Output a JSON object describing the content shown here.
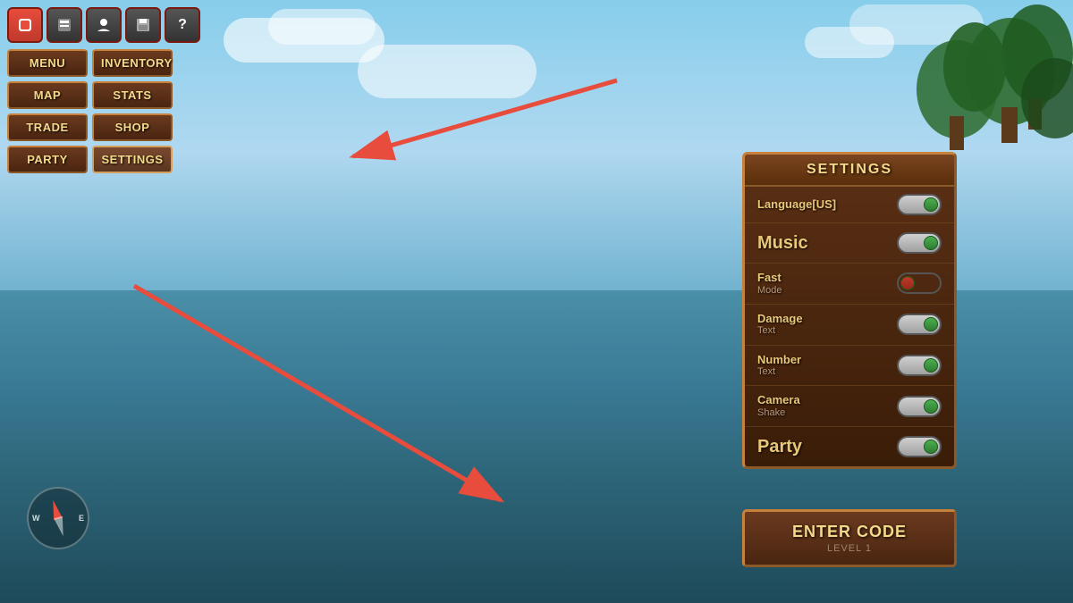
{
  "toolbar": {
    "icons": [
      "⬟",
      "📋",
      "👤",
      "💾",
      "?"
    ]
  },
  "nav": {
    "buttons": [
      {
        "label": "MENU",
        "id": "menu"
      },
      {
        "label": "INVENTORY",
        "id": "inventory"
      },
      {
        "label": "MAP",
        "id": "map"
      },
      {
        "label": "STATS",
        "id": "stats"
      },
      {
        "label": "TRADE",
        "id": "trade"
      },
      {
        "label": "SHOP",
        "id": "shop"
      },
      {
        "label": "PARTY",
        "id": "party"
      },
      {
        "label": "SETTINGS",
        "id": "settings"
      }
    ]
  },
  "settings": {
    "title": "SETTINGS",
    "rows": [
      {
        "label": "Language[US]",
        "size": "normal",
        "state": "on"
      },
      {
        "label": "Music",
        "size": "large",
        "state": "on"
      },
      {
        "label": "Fast",
        "sub": "Mode",
        "size": "normal",
        "state": "off"
      },
      {
        "label": "Damage",
        "sub": "Text",
        "size": "normal",
        "state": "on"
      },
      {
        "label": "Number",
        "sub": "Text",
        "size": "normal",
        "state": "on"
      },
      {
        "label": "Camera",
        "sub": "Shake",
        "size": "normal",
        "state": "on"
      },
      {
        "label": "Party",
        "size": "large",
        "state": "on"
      }
    ]
  },
  "enterCode": {
    "label": "ENTER CODE",
    "sublabel": "LEVEL 1"
  },
  "compass": {
    "labels": {
      "n": "",
      "s": "",
      "e": "E",
      "w": "W"
    }
  }
}
